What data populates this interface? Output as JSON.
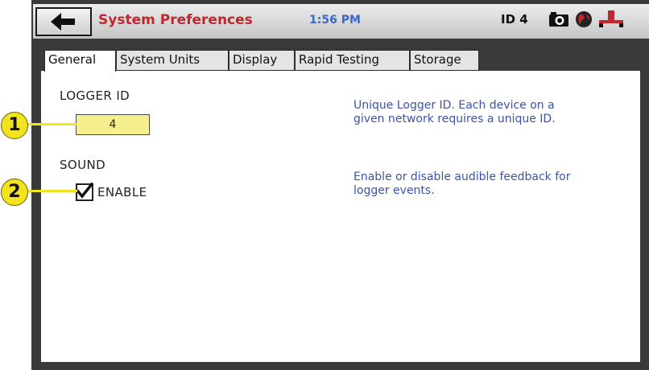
{
  "header": {
    "title": "System Preferences",
    "time": "1:56 PM",
    "device_id": "ID 4",
    "icons": [
      "back-arrow-icon",
      "camera-icon",
      "globe-icon",
      "network-icon"
    ]
  },
  "tabs": [
    {
      "label": "General",
      "active": true
    },
    {
      "label": "System Units",
      "active": false
    },
    {
      "label": "Display",
      "active": false
    },
    {
      "label": "Rapid Testing",
      "active": false
    },
    {
      "label": "Storage",
      "active": false
    }
  ],
  "general": {
    "logger_id_label": "LOGGER ID",
    "logger_id_value": "4",
    "logger_id_help": [
      "Unique Logger ID.  Each device on a",
      "given network requires a unique ID."
    ],
    "sound_label": "SOUND",
    "sound_enable_label": "ENABLE",
    "sound_enabled": true,
    "sound_help": [
      "Enable or disable audible feedback for",
      "logger events."
    ]
  },
  "callouts": [
    "1",
    "2"
  ],
  "colors": {
    "title": "#c0282e",
    "time": "#3a68c8",
    "help_text": "#3b54a6",
    "input_bg": "#f6ef8e",
    "callout": "#f3e31f"
  }
}
